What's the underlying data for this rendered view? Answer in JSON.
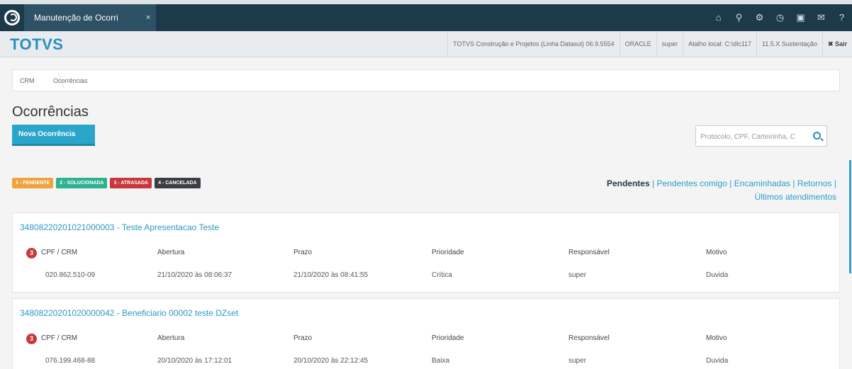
{
  "topbar": {
    "tab_label": "Manutenção de Ocorri",
    "tab_close": "×",
    "icons": [
      "home-icon",
      "sitemap-icon",
      "gear-icon",
      "clock-icon",
      "document-icon",
      "mail-icon",
      "help-icon"
    ],
    "icon_glyphs": [
      "⌂",
      "⚲",
      "⚙",
      "◷",
      "▣",
      "✉",
      "?"
    ]
  },
  "header": {
    "brand": "TOTVS",
    "info": [
      "TOTVS Construção e Projetos (Linha Datasul) 06.9.5554",
      "ORACLE",
      "super",
      "Atalho local: C:\\dlc117",
      "11.5.X Sustentação"
    ],
    "logout": "✖ Sair"
  },
  "breadcrumb": [
    "CRM",
    "Ocorrências"
  ],
  "page_title": "Ocorrências",
  "new_button": "Nova Ocorrência",
  "search": {
    "placeholder": "Protocolo, CPF, Carteirinha, C"
  },
  "legend": [
    {
      "label": "1 - PENDENTE",
      "color": "#f0a33c"
    },
    {
      "label": "2 - SOLUCIONADA",
      "color": "#2bb28e"
    },
    {
      "label": "3 - ATRASADA",
      "color": "#c8373c"
    },
    {
      "label": "4 - CANCELADA",
      "color": "#3b3f43"
    }
  ],
  "filters": [
    "Pendentes",
    "Pendentes comigo",
    "Encaminhadas",
    "Retornos",
    "Últimos atendimentos"
  ],
  "columns": [
    "CPF / CRM",
    "Abertura",
    "Prazo",
    "Prioridade",
    "Responsável",
    "Motivo"
  ],
  "cards": [
    {
      "title": "34808220201021000003 - Teste Apresentacao Teste",
      "status": "3",
      "values": [
        "020.862.510-09",
        "21/10/2020 às 08:06:37",
        "21/10/2020 às 08:41:55",
        "Crítica",
        "super",
        "Duvida"
      ]
    },
    {
      "title": "34808220201020000042 - Beneficiario 00002 teste DZset",
      "status": "3",
      "values": [
        "076.199.468-88",
        "20/10/2020 às 17:12:01",
        "20/10/2020 às 22:12:45",
        "Baixa",
        "super",
        "Duvida"
      ]
    }
  ]
}
